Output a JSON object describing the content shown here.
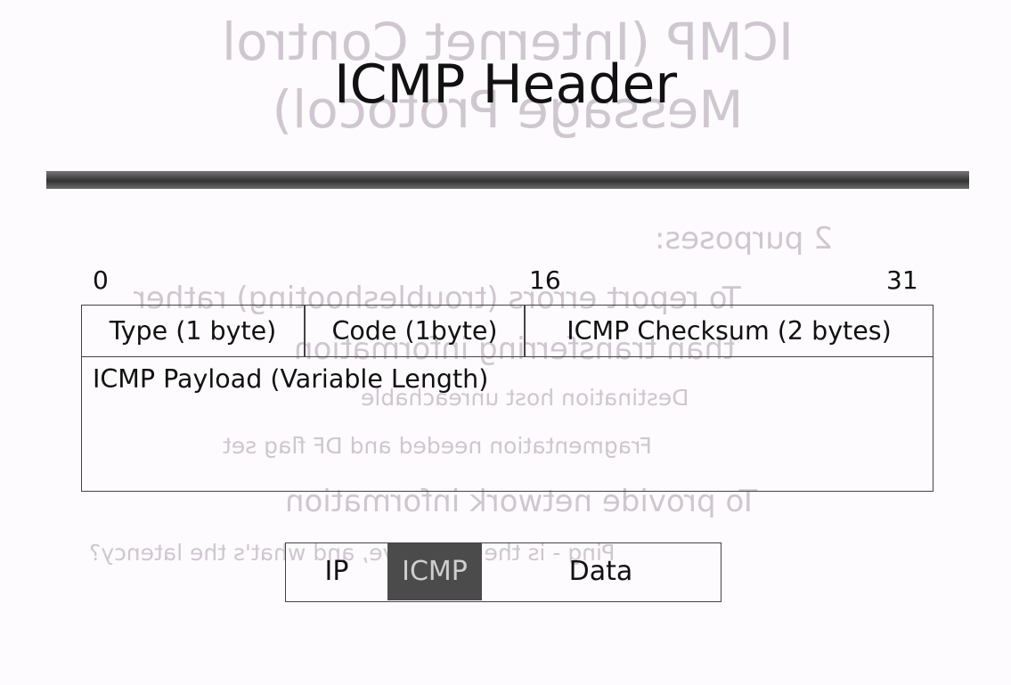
{
  "background_slide": {
    "title_line1": "ICMP (Internet Control",
    "title_line2": "Message Protocol)",
    "bullet": "2 purposes:",
    "sub1": "To report errors (troubleshooting) rather",
    "sub1b": "than transferring information",
    "item1": "Destination host unreachable",
    "item2": "Fragmentation needed and DF flag set",
    "sub2": "To provide network information",
    "item3": "Ping - is the host alive, and what's the latency?"
  },
  "title": "ICMP Header",
  "bit_positions": [
    "0",
    "16",
    "31"
  ],
  "header_fields": {
    "type": "Type (1 byte)",
    "code": "Code (1byte)",
    "checksum": "ICMP Checksum (2 bytes)",
    "payload": "ICMP Payload (Variable Length)"
  },
  "packet": {
    "ip": "IP",
    "icmp": "ICMP",
    "data": "Data"
  },
  "colors": {
    "rule": "#3f3f3f",
    "highlight": "#4b4b4b"
  }
}
